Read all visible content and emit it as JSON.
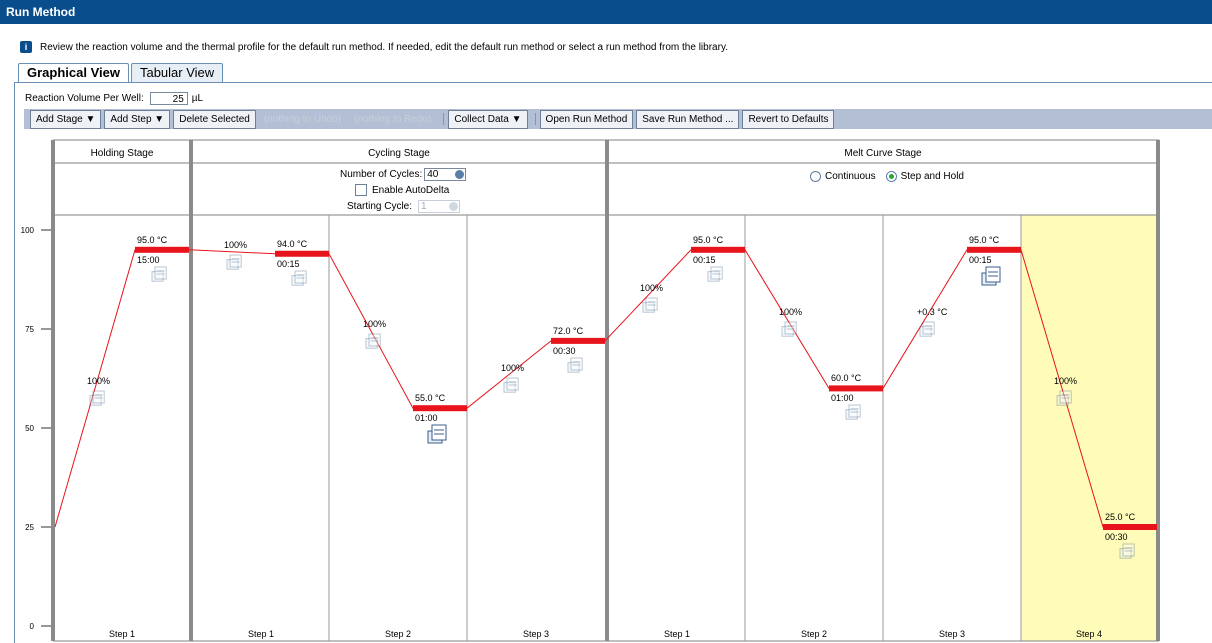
{
  "window": {
    "title": "Run Method"
  },
  "info": {
    "text": "Review the reaction volume and the thermal profile for the default run method. If needed, edit the default run method or select a run method from the library."
  },
  "tabs": [
    {
      "label": "Graphical View"
    },
    {
      "label": "Tabular View"
    }
  ],
  "reaction": {
    "label": "Reaction Volume Per Well:",
    "value": "25",
    "unit": "µL"
  },
  "toolbar": {
    "add_stage": "Add Stage ▼",
    "add_step": "Add Step ▼",
    "delete_selected": "Delete Selected",
    "undo": "(nothing to Undo)",
    "redo": "(nothing to Redo)",
    "collect_data": "Collect Data ▼",
    "open": "Open Run Method",
    "save": "Save Run Method ...",
    "revert": "Revert to Defaults"
  },
  "stages": {
    "holding": "Holding Stage",
    "cycling": "Cycling Stage",
    "melt": "Melt Curve Stage"
  },
  "cycling": {
    "cycles_label": "Number of Cycles:",
    "cycles": "40",
    "autodelta": "Enable AutoDelta",
    "start_label": "Starting Cycle:",
    "start": "1"
  },
  "melt": {
    "continuous": "Continuous",
    "step_hold": "Step and Hold"
  },
  "chart_data": {
    "type": "line",
    "yticks": [
      0,
      25,
      50,
      75,
      100
    ],
    "ylim": [
      0,
      100
    ],
    "grid": false,
    "steps": [
      {
        "stage": "holding",
        "label": "Step 1",
        "temp": "95.0 °C",
        "time": "15:00",
        "temp_v": 95.0,
        "ramp": "100%",
        "collect": false,
        "selected": false
      },
      {
        "stage": "cycling",
        "label": "Step 1",
        "temp": "94.0 °C",
        "time": "00:15",
        "temp_v": 94.0,
        "ramp": "100%",
        "collect": false,
        "selected": false
      },
      {
        "stage": "cycling",
        "label": "Step 2",
        "temp": "55.0 °C",
        "time": "01:00",
        "temp_v": 55.0,
        "ramp": "100%",
        "collect": true,
        "selected": false
      },
      {
        "stage": "cycling",
        "label": "Step 3",
        "temp": "72.0 °C",
        "time": "00:30",
        "temp_v": 72.0,
        "ramp": "100%",
        "collect": false,
        "selected": false
      },
      {
        "stage": "melt",
        "label": "Step 1",
        "temp": "95.0 °C",
        "time": "00:15",
        "temp_v": 95.0,
        "ramp": "100%",
        "collect": false,
        "selected": false
      },
      {
        "stage": "melt",
        "label": "Step 2",
        "temp": "60.0 °C",
        "time": "01:00",
        "temp_v": 60.0,
        "ramp": "100%",
        "collect": false,
        "selected": false
      },
      {
        "stage": "melt",
        "label": "Step 3",
        "temp": "95.0 °C",
        "time": "00:15",
        "temp_v": 95.0,
        "ramp": "+0.3 °C",
        "collect": true,
        "selected": false
      },
      {
        "stage": "melt",
        "label": "Step 4",
        "temp": "25.0 °C",
        "time": "00:30",
        "temp_v": 25.0,
        "ramp": "100%",
        "collect": false,
        "selected": true
      }
    ]
  },
  "colors": {
    "line": "#e8141c",
    "hold": "#e8141c",
    "selected_bg": "#fffbb8",
    "selected_border": "#e8d060",
    "divider": "#808080"
  }
}
